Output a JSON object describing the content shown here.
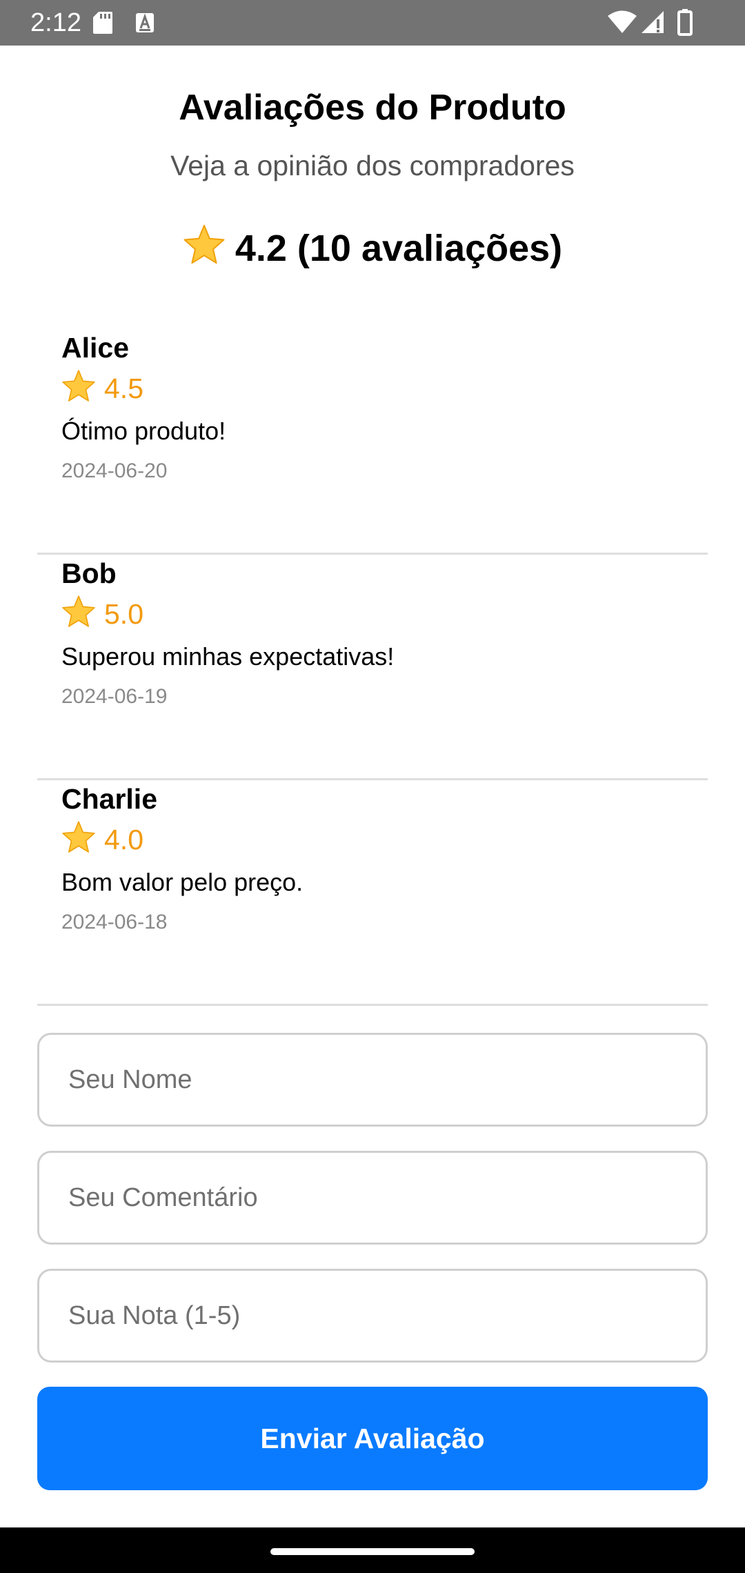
{
  "status_bar": {
    "time": "2:12"
  },
  "header": {
    "title": "Avaliações do Produto",
    "subtitle": "Veja a opinião dos compradores",
    "summary": "4.2 (10 avaliações)"
  },
  "reviews": [
    {
      "name": "Alice",
      "rating": "4.5",
      "comment": "Ótimo produto!",
      "date": "2024-06-20"
    },
    {
      "name": "Bob",
      "rating": "5.0",
      "comment": "Superou minhas expectativas!",
      "date": "2024-06-19"
    },
    {
      "name": "Charlie",
      "rating": "4.0",
      "comment": "Bom valor pelo preço.",
      "date": "2024-06-18"
    }
  ],
  "form": {
    "name_placeholder": "Seu Nome",
    "comment_placeholder": "Seu Comentário",
    "rating_placeholder": "Sua Nota (1-5)",
    "submit_label": "Enviar Avaliação"
  },
  "colors": {
    "accent": "#0a7bff",
    "star": "#ffc83d",
    "rating_text": "#f29a0e",
    "status_bar": "#737373"
  },
  "icons": [
    "sd-card-icon",
    "text-a-icon",
    "wifi-icon",
    "signal-icon",
    "battery-icon",
    "star-icon"
  ]
}
